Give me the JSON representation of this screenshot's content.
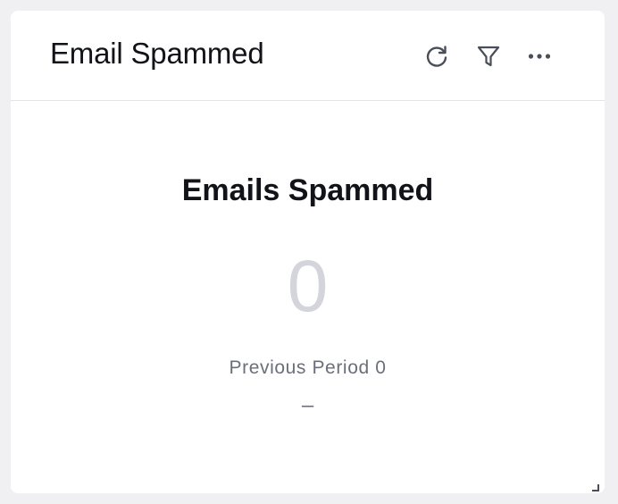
{
  "widget": {
    "title": "Email Spammed",
    "actions": {
      "refresh_icon": "refresh-icon",
      "filter_icon": "filter-icon",
      "more_icon": "more-horizontal-icon"
    },
    "metric": {
      "label": "Emails Spammed",
      "value": "0",
      "previous_period": "Previous Period 0",
      "change": "–"
    }
  },
  "colors": {
    "page_background": "#f0f0f2",
    "card_background": "#ffffff",
    "title_text": "#111318",
    "value_text": "#d4d5dc",
    "secondary_text": "#6b6f7a",
    "icon": "#4a4e58",
    "divider": "#e3e4e8"
  }
}
